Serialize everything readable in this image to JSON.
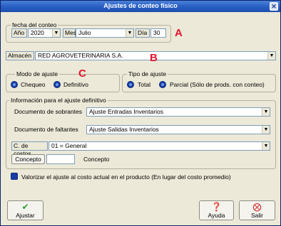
{
  "window": {
    "title": "Ajustes de conteo físico"
  },
  "fecha": {
    "group_label": "fecha del conteo",
    "year_label": "Año",
    "year_value": "2020",
    "month_label": "Mes",
    "month_value": "Julio",
    "day_label": "Día",
    "day_value": "30"
  },
  "almacen": {
    "label": "Almacén",
    "value": "RED AGROVETERINARIA S.A."
  },
  "modo": {
    "group_label": "Modo de ajuste",
    "options": [
      "Chequeo",
      "Definitivo"
    ],
    "selected": "Definitivo"
  },
  "tipo": {
    "group_label": "Tipo de ajuste",
    "options": [
      "Total",
      "Parcial  (Sólo de prods. con conteo)"
    ],
    "selected": "Parcial  (Sólo de prods. con conteo)"
  },
  "info": {
    "group_label": "Información  para el ajuste definitivo",
    "sobrantes_label": "Documento de sobrantes",
    "sobrantes_value": "Ajuste Entradas Inventarios",
    "faltantes_label": "Documento de faltantes",
    "faltantes_value": "Ajuste Salidas Inventarios",
    "costos_label": "C. de costos",
    "costos_value": "01 = General",
    "concepto_button": "Concepto",
    "concepto_input": "",
    "concepto_label": "Concepto"
  },
  "valorizar": {
    "label": "Valorizar el ajuste al costo actual en el producto  (En lugar del costo promedio)"
  },
  "annotations": [
    "A",
    "B",
    "C"
  ],
  "buttons": {
    "ajustar": "Ajustar",
    "ayuda": "Ayuda",
    "salir": "Salir"
  },
  "colors": {
    "title_bar": "#2a5fc4",
    "annotation": "#e0152d",
    "radio": "#173fa5"
  },
  "icons": [
    "close-icon",
    "chevron-down-icon",
    "check-icon",
    "help-icon",
    "exit-icon"
  ]
}
